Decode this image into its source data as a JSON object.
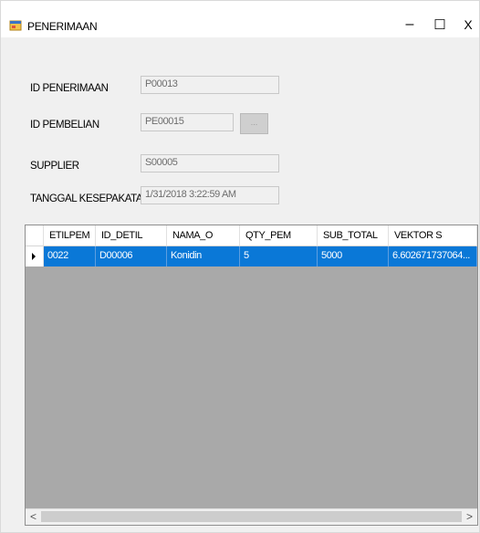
{
  "window": {
    "title": "PENERIMAAN",
    "minimize_symbol": "–",
    "maximize_symbol": "☐",
    "close_symbol": "X"
  },
  "form": {
    "id_penerimaan": {
      "label": "ID PENERIMAAN",
      "value": "P00013"
    },
    "id_pembelian": {
      "label": "ID PEMBELIAN",
      "value": "PE00015",
      "button_label": "..."
    },
    "supplier": {
      "label": "SUPPLIER",
      "value": "S00005"
    },
    "tanggal": {
      "label": "TANGGAL KESEPAKATAN",
      "value": "1/31/2018 3:22:59 AM"
    }
  },
  "grid": {
    "columns": [
      "ETILPEM",
      "ID_DETIL",
      "NAMA_O",
      "QTY_PEM",
      "SUB_TOTAL",
      "VEKTOR S"
    ],
    "rows": [
      [
        "0022",
        "D00006",
        "Konidin",
        "5",
        "5000",
        "6.602671737064..."
      ]
    ],
    "selected_row": 0
  },
  "scrollbar": {
    "left_arrow": "<",
    "right_arrow": ">"
  },
  "colors": {
    "selection": "#0a78d7",
    "grid_background": "#a9a9a9",
    "window_background": "#f0f0f0"
  }
}
